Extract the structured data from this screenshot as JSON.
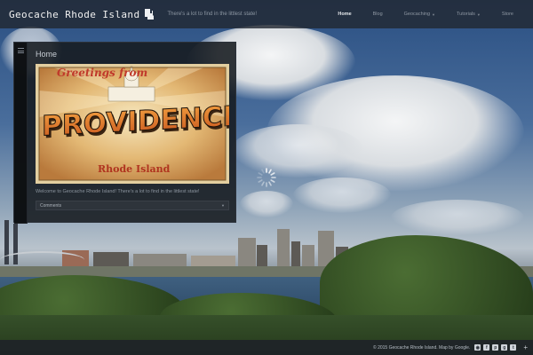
{
  "header": {
    "site_title": "Geocache Rhode Island",
    "tagline": "There's a lot to find in the littlest state!",
    "nav": [
      {
        "label": "Home",
        "active": true,
        "has_dropdown": false
      },
      {
        "label": "Blog",
        "active": false,
        "has_dropdown": false
      },
      {
        "label": "Geocaching",
        "active": false,
        "has_dropdown": true
      },
      {
        "label": "Tutorials",
        "active": false,
        "has_dropdown": true
      },
      {
        "label": "Store",
        "active": false,
        "has_dropdown": false
      }
    ]
  },
  "main": {
    "page_title": "Home",
    "postcard": {
      "greeting": "Greetings from",
      "city": "PROVIDENCE",
      "state": "Rhode Island"
    },
    "welcome_text": "Welcome to Geocache Rhode Island!  There's a lot to find in the littlest state!",
    "comments_label": "Comments"
  },
  "footer": {
    "copyright": "© 2015 Geocache Rhode Island. Map by Google.",
    "social_icons": [
      "rss-icon",
      "facebook-icon",
      "pinterest-icon",
      "google-plus-icon",
      "twitter-icon"
    ],
    "expand_symbol": "+"
  },
  "colors": {
    "topbar": "#222832",
    "panel": "#16191f",
    "postcard_letters": "#d9792a",
    "postcard_sky": "#e8c98c"
  }
}
